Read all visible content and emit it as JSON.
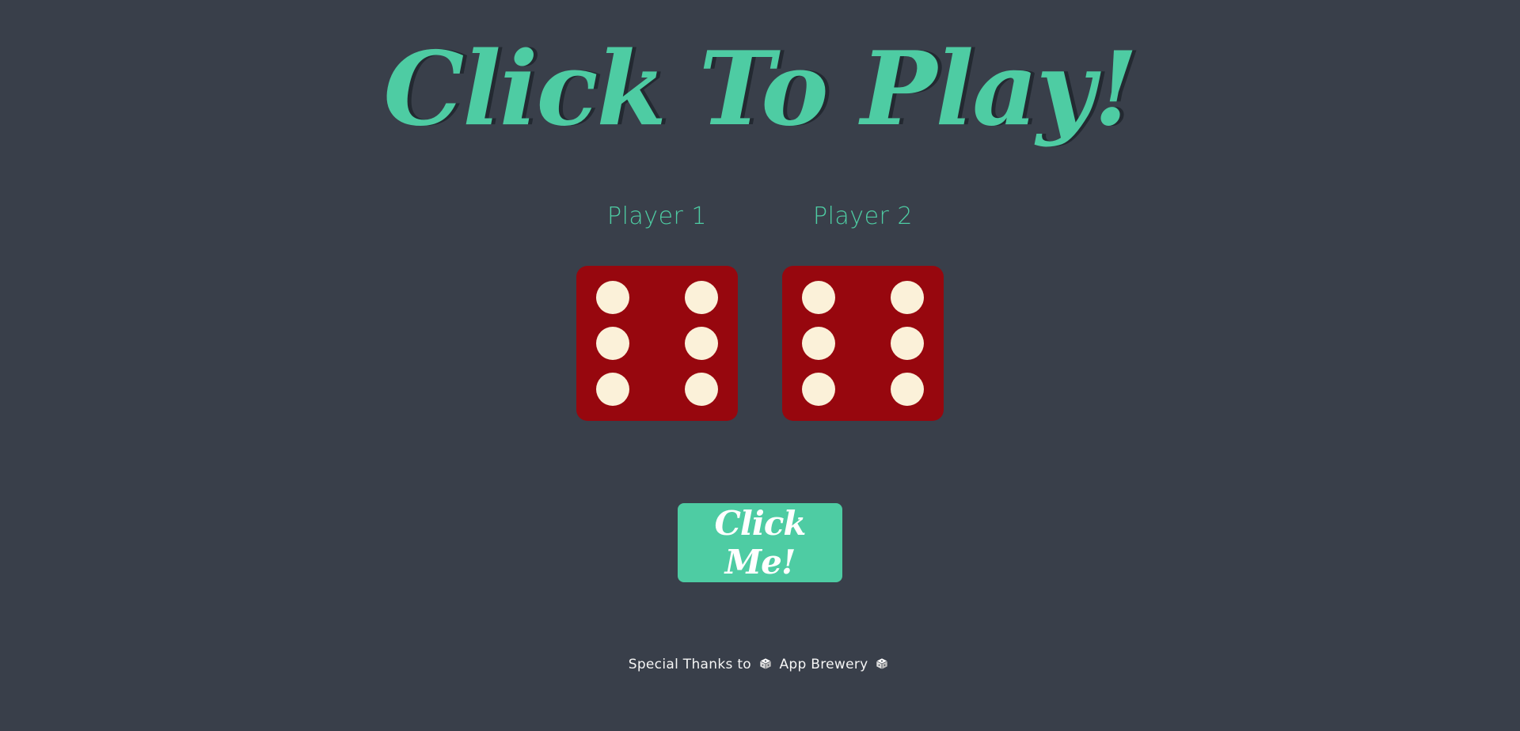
{
  "title": "Click To Play!",
  "players": [
    {
      "label": "Player 1",
      "die_value": 6
    },
    {
      "label": "Player 2",
      "die_value": 6
    }
  ],
  "button": {
    "label": "Click Me!"
  },
  "footer": {
    "prefix": "Special Thanks to",
    "brand": "App Brewery",
    "icon": "dice-icon"
  },
  "colors": {
    "background": "#393f4a",
    "accent": "#4ecca3",
    "title_shadow": "#232931",
    "die_face": "#97070e",
    "die_pip": "#fbf1d9",
    "footer_text": "#f5f5f5"
  }
}
